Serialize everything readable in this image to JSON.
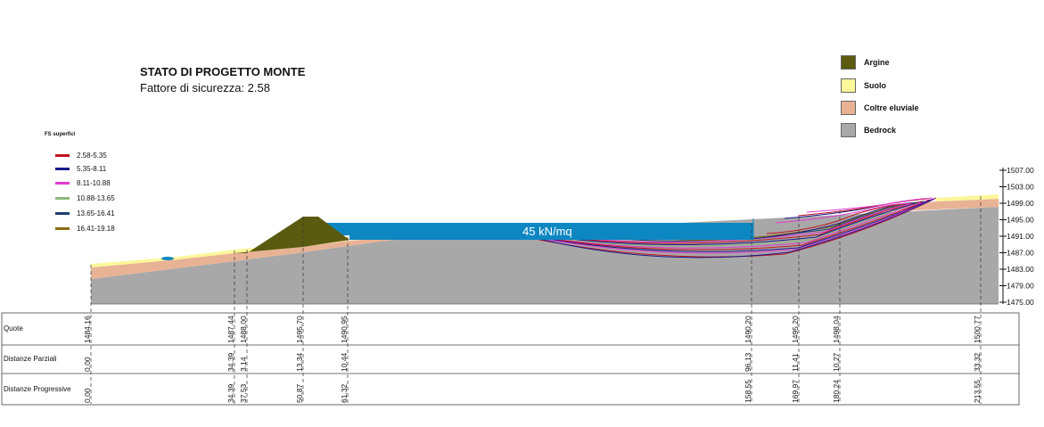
{
  "header": {
    "title": "STATO DI PROGETTO MONTE",
    "subtitle": "Fattore di sicurezza: 2.58"
  },
  "fs_legend": {
    "title": "FS superfici",
    "items": [
      {
        "label": "2.58-5.35",
        "color": "#c0141c"
      },
      {
        "label": "5.35-8.11",
        "color": "#1a1a8c"
      },
      {
        "label": "8.11-10.88",
        "color": "#e03cd0"
      },
      {
        "label": "10.88-13.65",
        "color": "#8fb87a"
      },
      {
        "label": "13.65-16.41",
        "color": "#1e3f6e"
      },
      {
        "label": "16.41-19.18",
        "color": "#8b6a10"
      }
    ]
  },
  "material_legend": [
    {
      "label": "Argine",
      "color": "#5a5a10"
    },
    {
      "label": "Suolo",
      "color": "#fbf79a"
    },
    {
      "label": "Coltre eluviale",
      "color": "#e8b295"
    },
    {
      "label": "Bedrock",
      "color": "#a8a8a8"
    }
  ],
  "load_label": "45 kN/mq",
  "colors": {
    "water": "#0d87c2",
    "bedrock": "#a8a8a8",
    "coltre": "#e8b295",
    "suolo": "#fbf79a",
    "argine": "#5a5a10"
  },
  "elevation_axis": {
    "ticks": [
      "1507.00",
      "1503.00",
      "1499.00",
      "1495.00",
      "1491.00",
      "1487.00",
      "1483.00",
      "1479.00",
      "1475.00"
    ]
  },
  "table": {
    "row_labels": [
      "Quote",
      "Distanze Parziali",
      "Distanze Progressive"
    ],
    "columns": [
      {
        "quota": "1484.16",
        "parziale": "0.00",
        "progressiva": "0.00"
      },
      {
        "quota": "1487.44",
        "parziale": "34.39",
        "progressiva": "34.39"
      },
      {
        "quota": "1488.00",
        "parziale": "3.14",
        "progressiva": "37.53"
      },
      {
        "quota": "1495.70",
        "parziale": "13.34",
        "progressiva": "50.87"
      },
      {
        "quota": "1490.95",
        "parziale": "10.44",
        "progressiva": "61.32"
      },
      {
        "quota": "1490.20",
        "parziale": "96.13",
        "progressiva": "158.55"
      },
      {
        "quota": "1495.20",
        "parziale": "11.41",
        "progressiva": "169.97"
      },
      {
        "quota": "1498.04",
        "parziale": "10.27",
        "progressiva": "180.24"
      },
      {
        "quota": "1500.77",
        "parziale": "33.32",
        "progressiva": "213.55"
      }
    ]
  }
}
